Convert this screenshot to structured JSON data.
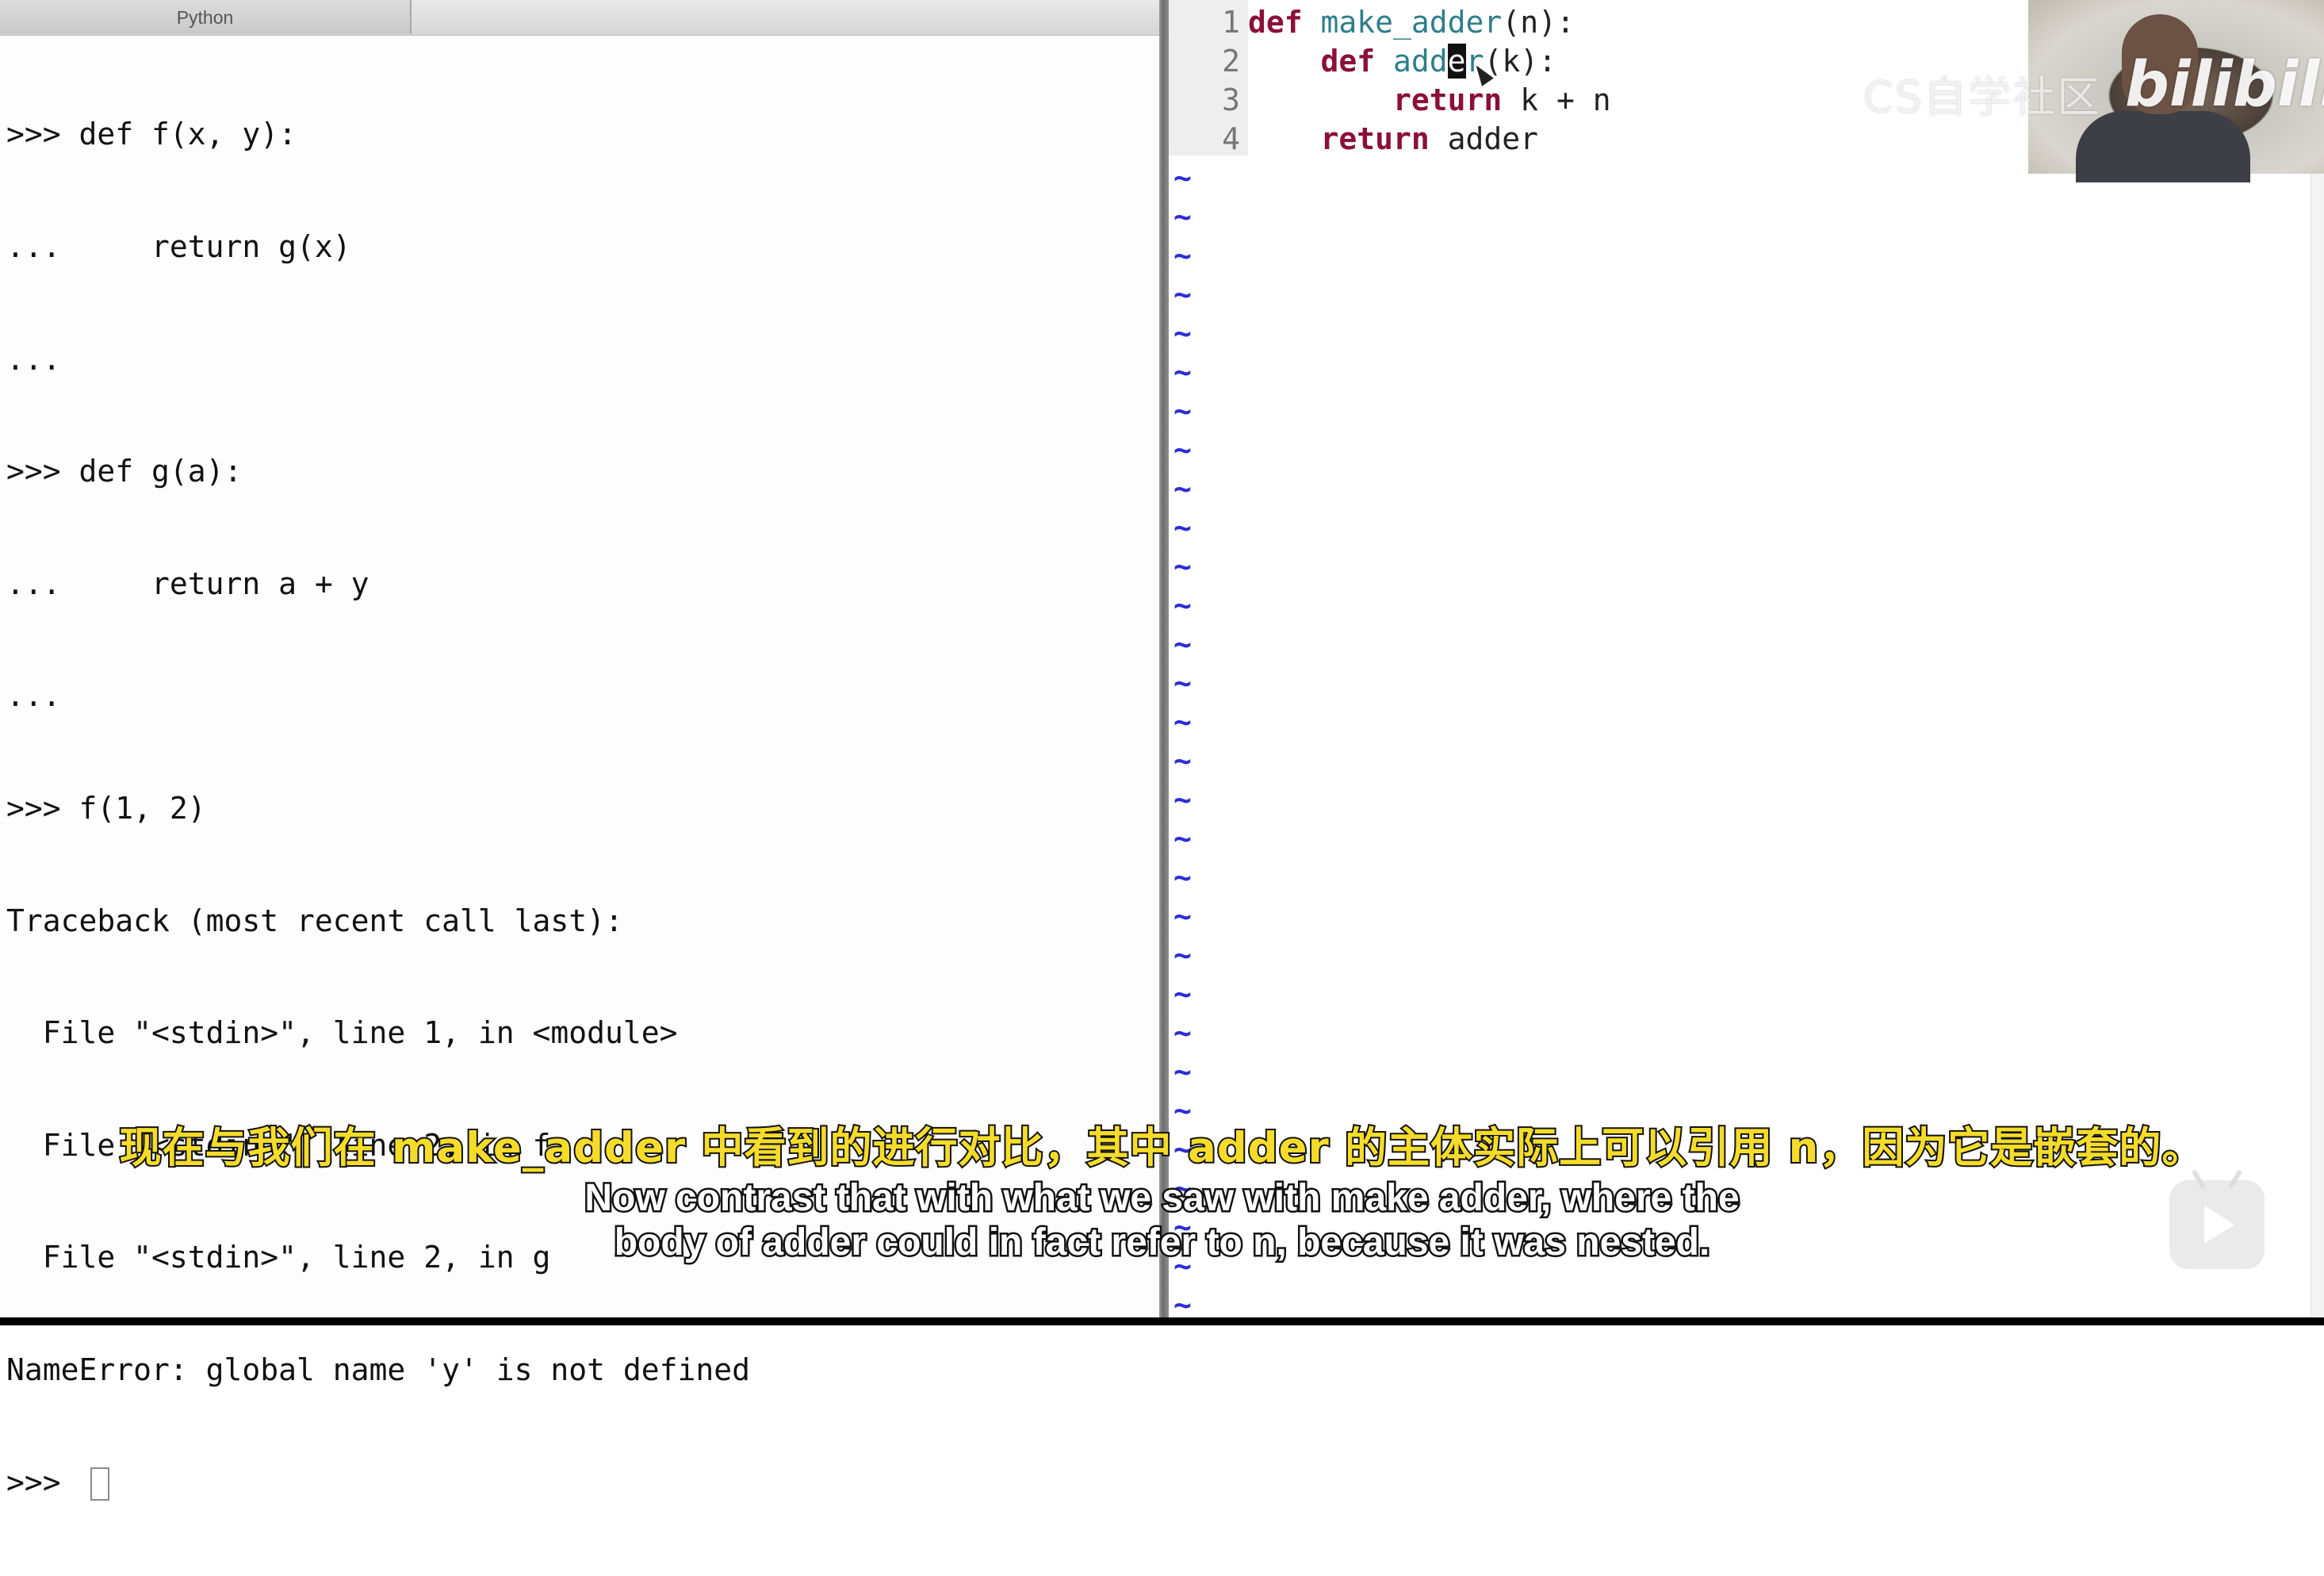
{
  "terminal": {
    "tab_title": "Python",
    "lines": [
      ">>> def f(x, y):",
      "...     return g(x)",
      "...",
      ">>> def g(a):",
      "...     return a + y",
      "...",
      ">>> f(1, 2)",
      "Traceback (most recent call last):",
      "  File \"<stdin>\", line 1, in <module>",
      "  File \"<stdin>\", line 2, in f",
      "  File \"<stdin>\", line 2, in g",
      "NameError: global name 'y' is not defined"
    ],
    "prompt": ">>> "
  },
  "editor": {
    "lines": [
      {
        "num": "1",
        "indent": "",
        "kw": "def",
        "name": " make_adder",
        "rest": "(n):"
      },
      {
        "num": "2",
        "indent": "    ",
        "kw": "def",
        "name": " add",
        "cursor_char": "e",
        "name_tail": "r",
        "rest": "(k):"
      },
      {
        "num": "3",
        "indent": "        ",
        "kw": "return",
        "rest": " k + n"
      },
      {
        "num": "4",
        "indent": "    ",
        "kw": "return",
        "rest": " adder"
      }
    ],
    "empty_line_marker": "~",
    "colors": {
      "keyword": "#8b0f3a",
      "function_name": "#2d7f8a",
      "tilde": "#2d2dd6"
    }
  },
  "overlay": {
    "watermark": "CS自学社区",
    "logo": "bilibili",
    "subtitle_cn": "现在与我们在 make_adder 中看到的进行对比，其中 adder 的主体实际上可以引用 n，因为它是嵌套的。",
    "subtitle_en_line1": "Now contrast that with what we saw with make adder, where the",
    "subtitle_en_line2": "body of adder could in fact refer to n, because it was nested.",
    "play_icon": "play-icon"
  }
}
